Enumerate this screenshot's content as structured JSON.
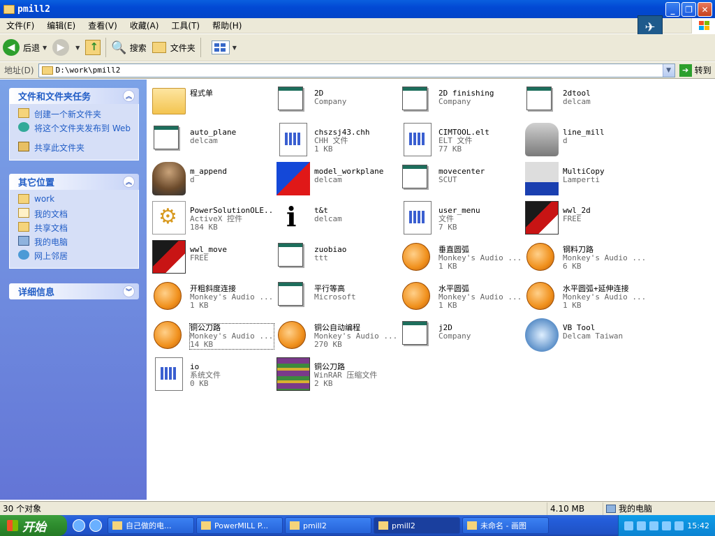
{
  "window": {
    "title": "pmill2"
  },
  "menu": [
    "文件(F)",
    "编辑(E)",
    "查看(V)",
    "收藏(A)",
    "工具(T)",
    "帮助(H)"
  ],
  "toolbar": {
    "back": "后退",
    "search": "搜索",
    "folders": "文件夹"
  },
  "address": {
    "label": "地址(D)",
    "value": "D:\\work\\pmill2",
    "go": "转到"
  },
  "tasks_panel": {
    "title": "文件和文件夹任务",
    "items": [
      "创建一个新文件夹",
      "将这个文件夹发布到 Web",
      "共享此文件夹"
    ]
  },
  "places_panel": {
    "title": "其它位置",
    "items": [
      "work",
      "我的文档",
      "共享文档",
      "我的电脑",
      "网上邻居"
    ]
  },
  "details_panel": {
    "title": "详细信息"
  },
  "files": [
    {
      "name": "程式单",
      "type": "",
      "size": "",
      "icon": "folder"
    },
    {
      "name": "2D",
      "type": "Company",
      "size": "",
      "icon": "win"
    },
    {
      "name": "2D finishing",
      "type": "Company",
      "size": "",
      "icon": "win"
    },
    {
      "name": "2dtool",
      "type": "delcam",
      "size": "",
      "icon": "win"
    },
    {
      "name": "auto_plane",
      "type": "delcam",
      "size": "",
      "icon": "win"
    },
    {
      "name": "chszsj43.chh",
      "type": "CHH 文件",
      "size": "1 KB",
      "icon": "doc"
    },
    {
      "name": "CIMTOOL.elt",
      "type": "ELT 文件",
      "size": "77 KB",
      "icon": "doc"
    },
    {
      "name": "line_mill",
      "type": "d",
      "size": "",
      "icon": "mill"
    },
    {
      "name": "m_append",
      "type": "d",
      "size": "",
      "icon": "robot"
    },
    {
      "name": "model_workplane",
      "type": "delcam",
      "size": "",
      "icon": "workplane"
    },
    {
      "name": "movecenter",
      "type": "SCUT",
      "size": "",
      "icon": "win"
    },
    {
      "name": "MultiCopy",
      "type": "Lamperti",
      "size": "",
      "icon": "multicopy"
    },
    {
      "name": "PowerSolutionOLE...",
      "type": "ActiveX 控件",
      "size": "184 KB",
      "icon": "psol"
    },
    {
      "name": "t&t",
      "type": "delcam",
      "size": "",
      "icon": "tat"
    },
    {
      "name": "user_menu",
      "type": "文件",
      "size": "7 KB",
      "icon": "doc"
    },
    {
      "name": "wwl_2d",
      "type": "FREE",
      "size": "",
      "icon": "wwl"
    },
    {
      "name": "wwl_move",
      "type": "FREE",
      "size": "",
      "icon": "wwl"
    },
    {
      "name": "zuobiao",
      "type": "ttt",
      "size": "",
      "icon": "win"
    },
    {
      "name": "垂直圆弧",
      "type": "Monkey's Audio ...",
      "size": "1 KB",
      "icon": "audio"
    },
    {
      "name": "钢料刀路",
      "type": "Monkey's Audio ...",
      "size": "6 KB",
      "icon": "audio"
    },
    {
      "name": "开粗斜度连接",
      "type": "Monkey's Audio ...",
      "size": "1 KB",
      "icon": "audio"
    },
    {
      "name": "平行等高",
      "type": "Microsoft",
      "size": "",
      "icon": "win"
    },
    {
      "name": "水平圆弧",
      "type": "Monkey's Audio ...",
      "size": "1 KB",
      "icon": "audio"
    },
    {
      "name": "水平圆弧+延伸连接",
      "type": "Monkey's Audio ...",
      "size": "1 KB",
      "icon": "audio"
    },
    {
      "name": "铜公刀路",
      "type": "Monkey's Audio ...",
      "size": "14 KB",
      "icon": "audio",
      "selected": true
    },
    {
      "name": "铜公自动编程",
      "type": "Monkey's Audio ...",
      "size": "270 KB",
      "icon": "audio"
    },
    {
      "name": "j2D",
      "type": "Company",
      "size": "",
      "icon": "win"
    },
    {
      "name": "VB Tool",
      "type": "Delcam Taiwan",
      "size": "",
      "icon": "vb"
    },
    {
      "name": "io",
      "type": "系统文件",
      "size": "0 KB",
      "icon": "doc"
    },
    {
      "name": "铜公刀路",
      "type": "WinRAR 压缩文件",
      "size": "2 KB",
      "icon": "rar"
    }
  ],
  "status": {
    "count": "30 个对象",
    "size": "4.10 MB",
    "location": "我的电脑"
  },
  "taskbar": {
    "start": "开始",
    "tasks": [
      "自己做的电...",
      "PowerMILL P...",
      "pmill2",
      "pmill2",
      "未命名 - 画图"
    ],
    "clock": "15:42"
  }
}
